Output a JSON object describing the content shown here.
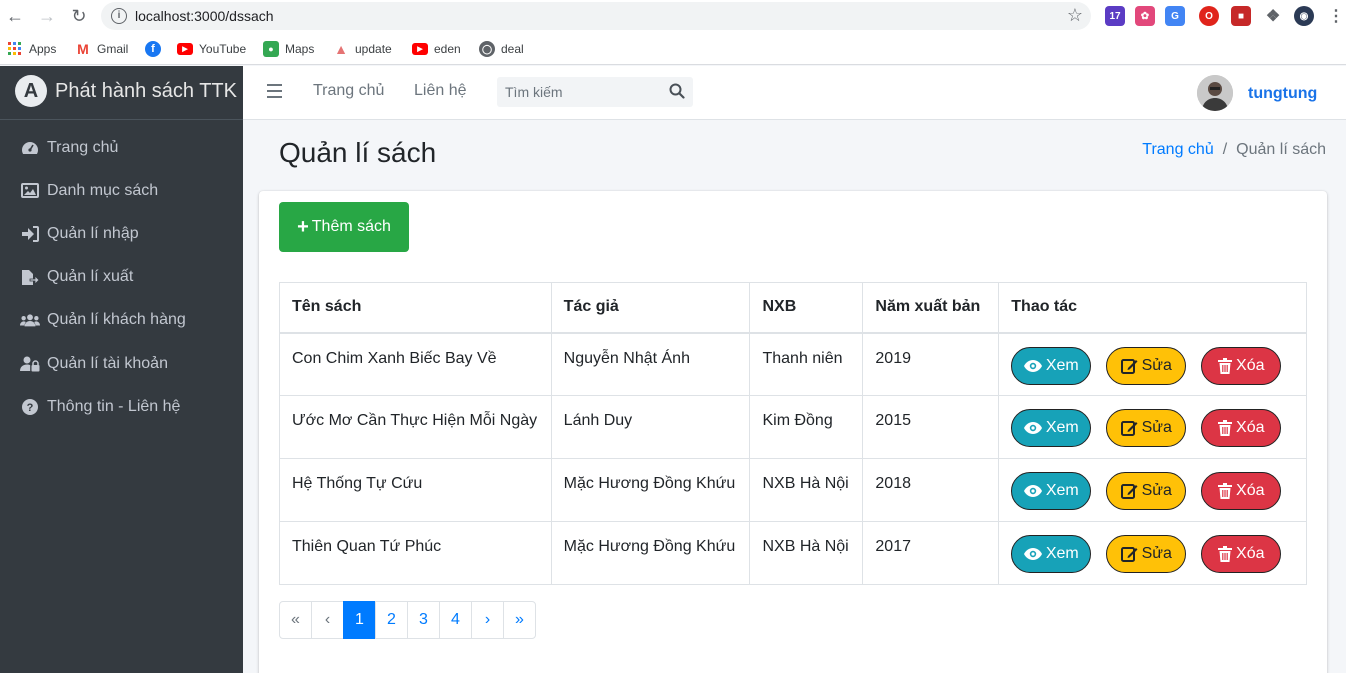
{
  "browser": {
    "url": "localhost:3000/dssach",
    "extension_badge": "17",
    "bookmarks": [
      {
        "label": "Apps"
      },
      {
        "label": "Gmail"
      },
      {
        "label": ""
      },
      {
        "label": "YouTube"
      },
      {
        "label": "Maps"
      },
      {
        "label": "update"
      },
      {
        "label": "eden"
      },
      {
        "label": "deal"
      }
    ]
  },
  "sidebar": {
    "brand": "Phát hành sách TTK",
    "items": [
      {
        "label": "Trang chủ",
        "icon": "dashboard-icon"
      },
      {
        "label": "Danh mục sách",
        "icon": "image-icon"
      },
      {
        "label": "Quản lí nhập",
        "icon": "sign-in-icon"
      },
      {
        "label": "Quản lí xuất",
        "icon": "file-export-icon"
      },
      {
        "label": "Quản lí khách hàng",
        "icon": "users-icon"
      },
      {
        "label": "Quản lí tài khoản",
        "icon": "user-lock-icon"
      },
      {
        "label": "Thông tin - Liên hệ",
        "icon": "question-circle-icon"
      }
    ]
  },
  "navbar": {
    "home": "Trang chủ",
    "contact": "Liên hệ",
    "search_placeholder": "Tìm kiếm",
    "username": "tungtung"
  },
  "page": {
    "title": "Quản lí sách",
    "breadcrumb": {
      "home": "Trang chủ",
      "sep": "/",
      "current": "Quản lí sách"
    },
    "add_button": "Thêm sách"
  },
  "table": {
    "headers": [
      "Tên sách",
      "Tác giả",
      "NXB",
      "Năm xuất bản",
      "Thao tác"
    ],
    "rows": [
      [
        "Con Chim Xanh Biếc Bay Về",
        "Nguyễn Nhật Ánh",
        "Thanh niên",
        "2019"
      ],
      [
        "Ước Mơ Cần Thực Hiện Mỗi Ngày",
        "Lánh Duy",
        "Kim Đồng",
        "2015"
      ],
      [
        "Hệ Thống Tự Cứu",
        "Mặc Hương Đồng Khứu",
        "NXB Hà Nội",
        "2018"
      ],
      [
        "Thiên Quan Tứ Phúc",
        "Mặc Hương Đồng Khứu",
        "NXB Hà Nội",
        "2017"
      ]
    ],
    "actions": {
      "view": "Xem",
      "edit": "Sửa",
      "delete": "Xóa"
    }
  },
  "pagination": {
    "first": "«",
    "prev": "‹",
    "pages": [
      "1",
      "2",
      "3",
      "4"
    ],
    "active": "1",
    "next": "›",
    "last": "»"
  },
  "colors": {
    "sidebar": "#343a40",
    "primary": "#007bff",
    "success": "#28a745",
    "info": "#17a2b8",
    "warning": "#ffc107",
    "danger": "#dc3545"
  }
}
